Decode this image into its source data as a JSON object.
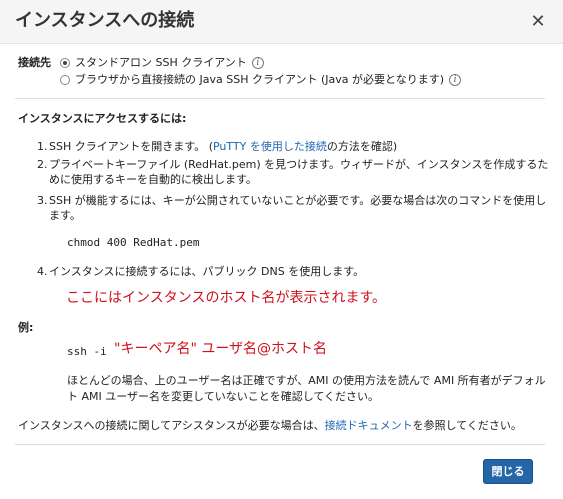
{
  "dialog": {
    "title": "インスタンスへの接続",
    "close_symbol": "✕"
  },
  "connection": {
    "label": "接続先",
    "options": [
      {
        "label": "スタンドアロン SSH クライアント",
        "selected": true
      },
      {
        "label": "ブラウザから直接接続の Java SSH クライアント (Java が必要となります)",
        "selected": false
      }
    ],
    "info_icon": "info-icon"
  },
  "instructions": {
    "title": "インスタンスにアクセスするには:",
    "step1": {
      "num": "1.",
      "text_before": "SSH クライアントを開きます。 (",
      "link": "PuTTY を使用した接続",
      "text_after": "の方法を確認)"
    },
    "step2": {
      "num": "2.",
      "text": "プライベートキーファイル (RedHat.pem) を見つけます。ウィザードが、インスタンスを作成するために使用するキーを自動的に検出します。"
    },
    "step3": {
      "num": "3.",
      "text": "SSH が機能するには、キーが公開されていないことが必要です。必要な場合は次のコマンドを使用します。",
      "command": "chmod 400 RedHat.pem"
    },
    "step4": {
      "num": "4.",
      "text": "インスタンスに接続するには、パブリック DNS を使用します。"
    },
    "dns_annotation": "ここにはインスタンスのホスト名が表示されます。"
  },
  "example": {
    "label": "例:",
    "command_prefix": "ssh -i",
    "command_annotation": "\"キーペア名\" ユーザ名@ホスト名",
    "note": "ほとんどの場合、上のユーザー名は正確ですが、AMI の使用方法を読んで AMI 所有者がデフォルト AMI ユーザー名を変更していないことを確認してください。"
  },
  "help": {
    "text_before": "インスタンスへの接続に関してアシスタンスが必要な場合は、",
    "link": "接続ドキュメント",
    "text_after": "を参照してください。"
  },
  "footer": {
    "close_label": "閉じる"
  },
  "colors": {
    "accent": "#2466a8",
    "link": "#1f67b1",
    "annotation": "#d0101a"
  }
}
